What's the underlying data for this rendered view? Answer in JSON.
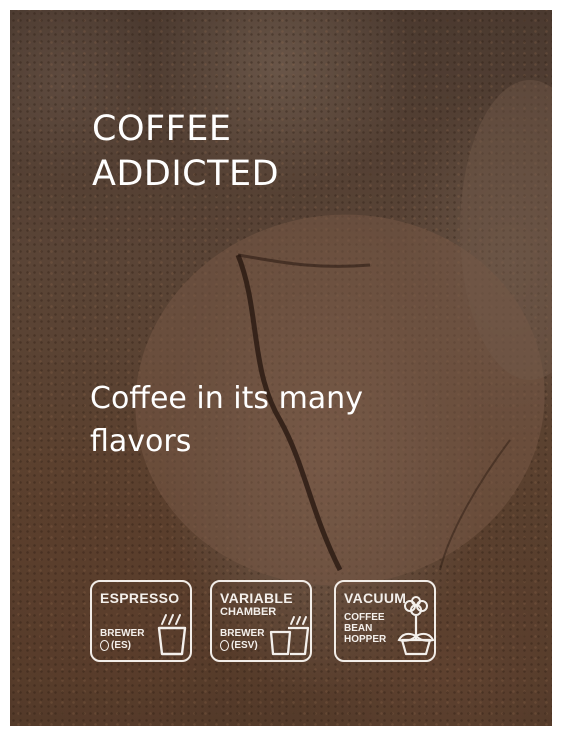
{
  "hero": {
    "title_line1": "COFFEE",
    "title_line2": "ADDICTED",
    "subtitle": "Coffee in its many flavors"
  },
  "badges": [
    {
      "title": "ESPRESSO",
      "label_line1": "BREWER",
      "label_line2": "(ES)",
      "icon": "espresso-cup-icon"
    },
    {
      "title": "VARIABLE",
      "subtitle": "CHAMBER",
      "label_line1": "BREWER",
      "label_line2": "(ESV)",
      "icon": "double-cup-icon"
    },
    {
      "title": "VACUUM",
      "label_line1": "COFFEE",
      "label_line2": "BEAN",
      "label_line3": "HOPPER",
      "icon": "flower-pot-icon"
    }
  ],
  "colors": {
    "text": "#ffffff",
    "badge_outline": "#f2ede8",
    "background_dark": "#4b3a30"
  }
}
